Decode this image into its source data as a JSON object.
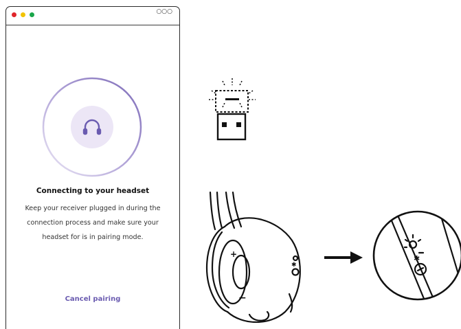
{
  "window": {
    "menu_icon": "more-dots-icon",
    "heading": "Connecting to your headset",
    "description": "Keep your receiver plugged in during the connection process and make sure your headset for is in pairing mode.",
    "cancel_label": "Cancel pairing",
    "progress_icon": "headphones-icon"
  },
  "colors": {
    "accent": "#6a5bb0",
    "icon_bg": "#ece6f6",
    "ring": "#7d6bb8"
  },
  "illustrations": {
    "receiver_icon": "usb-receiver-icon",
    "headset_icon": "headset-earcup-icon",
    "arrow_icon": "arrow-right-icon",
    "detail_icon": "bluetooth-pairing-button-icon",
    "earcup_plus": "+",
    "earcup_minus": "−"
  }
}
